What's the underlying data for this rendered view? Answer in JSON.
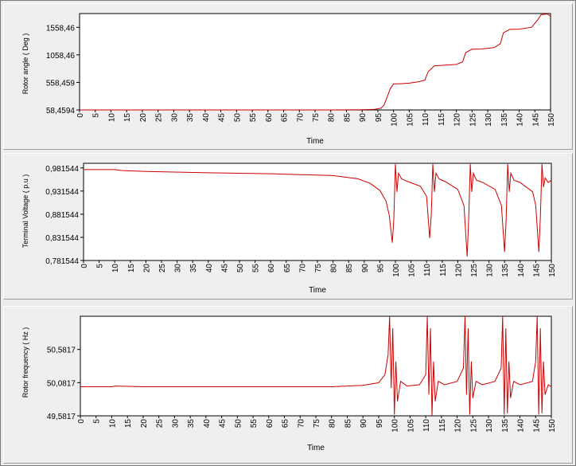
{
  "chart_data": [
    {
      "type": "line",
      "title": "",
      "xlabel": "Time",
      "ylabel": "Rotor angle ( Deg )",
      "xlim": [
        0,
        150
      ],
      "ylim": [
        58.4594,
        1808.46
      ],
      "x_ticks": [
        "0",
        "5",
        "10",
        "15",
        "20",
        "25",
        "30",
        "35",
        "40",
        "45",
        "50",
        "55",
        "60",
        "65",
        "70",
        "75",
        "80",
        "85",
        "90",
        "95",
        "100",
        "105",
        "110",
        "115",
        "120",
        "125",
        "130",
        "135",
        "140",
        "145",
        "150"
      ],
      "y_ticks": [
        {
          "value": 58.4594,
          "label": "58,4594"
        },
        {
          "value": 558.459,
          "label": "558,459"
        },
        {
          "value": 1058.46,
          "label": "1058,46"
        },
        {
          "value": 1558.46,
          "label": "1558,46"
        }
      ],
      "series_color": "#cc0000",
      "series": [
        {
          "x": [
            0,
            80,
            85,
            90,
            94,
            96,
            97,
            98,
            99,
            100,
            102,
            105,
            108,
            110,
            111,
            113,
            116,
            120,
            122,
            123,
            125,
            128,
            132,
            134,
            135,
            137,
            140,
            144,
            146,
            147,
            149,
            150
          ],
          "y": [
            58.46,
            58.46,
            60,
            63,
            70,
            90,
            150,
            300,
            450,
            530,
            535,
            545,
            570,
            600,
            750,
            860,
            870,
            885,
            930,
            1100,
            1160,
            1165,
            1190,
            1260,
            1460,
            1520,
            1525,
            1560,
            1700,
            1790,
            1800,
            1760
          ]
        }
      ]
    },
    {
      "type": "line",
      "title": "",
      "xlabel": "Time",
      "ylabel": "Terminal Voltage ( p.u )",
      "xlim": [
        0,
        150
      ],
      "ylim": [
        0.781544,
        0.991544
      ],
      "x_ticks": [
        "0",
        "5",
        "10",
        "15",
        "20",
        "25",
        "30",
        "35",
        "40",
        "45",
        "50",
        "55",
        "60",
        "65",
        "70",
        "75",
        "80",
        "85",
        "90",
        "95",
        "100",
        "105",
        "110",
        "115",
        "120",
        "125",
        "130",
        "135",
        "140",
        "145",
        "150"
      ],
      "y_ticks": [
        {
          "value": 0.781544,
          "label": "0,781544"
        },
        {
          "value": 0.831544,
          "label": "0,831544"
        },
        {
          "value": 0.881544,
          "label": "0,881544"
        },
        {
          "value": 0.931544,
          "label": "0,931544"
        },
        {
          "value": 0.981544,
          "label": "0,981544"
        }
      ],
      "series_color": "#cc0000",
      "series": [
        {
          "x": [
            0,
            10,
            12,
            20,
            40,
            60,
            80,
            88,
            92,
            95,
            97,
            98,
            99,
            99.5,
            100,
            100.5,
            101,
            102,
            104,
            108,
            110,
            111,
            111.5,
            112,
            112.5,
            113,
            114,
            116,
            120,
            122,
            123,
            123.5,
            124,
            124.5,
            125,
            126,
            128,
            132,
            134,
            135,
            135.5,
            136,
            136.5,
            137,
            138,
            140,
            144,
            145,
            146,
            146.5,
            147,
            147.5,
            148,
            149,
            150
          ],
          "y": [
            0.978,
            0.978,
            0.976,
            0.974,
            0.971,
            0.969,
            0.965,
            0.958,
            0.948,
            0.933,
            0.91,
            0.88,
            0.82,
            0.87,
            0.99,
            0.93,
            0.97,
            0.958,
            0.952,
            0.942,
            0.92,
            0.83,
            0.88,
            0.99,
            0.93,
            0.97,
            0.958,
            0.952,
            0.935,
            0.9,
            0.79,
            0.87,
            0.99,
            0.93,
            0.97,
            0.955,
            0.95,
            0.935,
            0.9,
            0.8,
            0.87,
            0.99,
            0.93,
            0.97,
            0.955,
            0.95,
            0.93,
            0.9,
            0.8,
            0.88,
            0.99,
            0.94,
            0.96,
            0.95,
            0.955
          ]
        }
      ]
    },
    {
      "type": "line",
      "title": "",
      "xlabel": "Time",
      "ylabel": "Rotor frequency ( Hz )",
      "xlim": [
        0,
        150
      ],
      "ylim": [
        49.5817,
        51.0817
      ],
      "x_ticks": [
        "0",
        "5",
        "10",
        "15",
        "20",
        "25",
        "30",
        "35",
        "40",
        "45",
        "50",
        "55",
        "60",
        "65",
        "70",
        "75",
        "80",
        "85",
        "90",
        "95",
        "100",
        "105",
        "110",
        "115",
        "120",
        "125",
        "130",
        "135",
        "140",
        "145",
        "150"
      ],
      "y_ticks": [
        {
          "value": 49.5817,
          "label": "49,5817"
        },
        {
          "value": 50.0817,
          "label": "50,0817"
        },
        {
          "value": 50.5817,
          "label": "50,5817"
        }
      ],
      "series_color": "#cc0000",
      "series": [
        {
          "x": [
            0,
            10,
            11,
            20,
            40,
            60,
            80,
            90,
            95,
            97,
            98,
            98.5,
            99,
            99.5,
            100,
            100.5,
            101,
            102,
            104,
            108,
            110,
            110.5,
            111,
            111.5,
            112,
            112.5,
            113,
            114,
            116,
            120,
            122,
            122.5,
            123,
            123.5,
            124,
            124.5,
            125,
            126,
            128,
            132,
            134,
            134.5,
            135,
            135.5,
            136,
            136.5,
            137,
            138,
            140,
            144,
            145,
            145.5,
            146,
            146.5,
            147,
            147.5,
            148,
            149,
            150
          ],
          "y": [
            50.02,
            50.02,
            50.03,
            50.02,
            50.02,
            50.02,
            50.02,
            50.04,
            50.08,
            50.2,
            50.5,
            51.08,
            50.0,
            50.9,
            49.6,
            50.4,
            49.8,
            50.1,
            50.03,
            50.05,
            50.2,
            51.08,
            49.9,
            50.9,
            49.58,
            50.4,
            49.8,
            50.1,
            50.05,
            50.1,
            50.3,
            51.08,
            49.9,
            50.9,
            49.6,
            50.4,
            49.85,
            50.1,
            50.05,
            50.1,
            50.3,
            51.08,
            49.6,
            50.9,
            49.62,
            50.4,
            49.85,
            50.1,
            50.05,
            50.1,
            50.4,
            51.08,
            49.6,
            50.9,
            49.62,
            50.4,
            49.9,
            50.05,
            50.02
          ]
        }
      ]
    }
  ]
}
